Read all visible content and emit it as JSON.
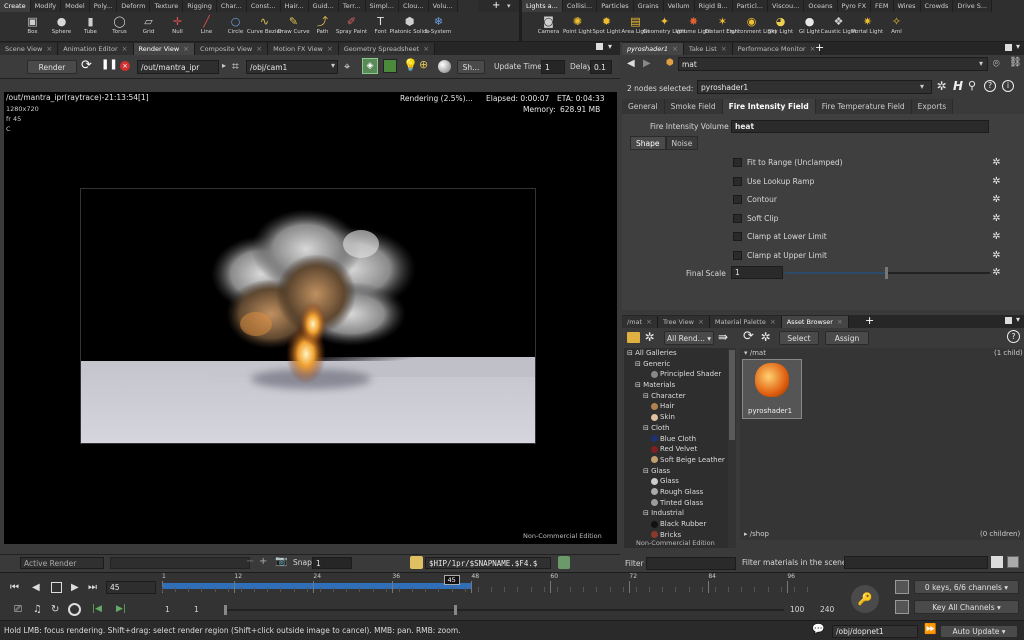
{
  "shelf_tabs_left": [
    "Create",
    "Modify",
    "Model",
    "Poly...",
    "Deform",
    "Texture",
    "Rigging",
    "Char...",
    "Const...",
    "Hair...",
    "Guid...",
    "Terr...",
    "Simpl...",
    "Clou...",
    "Volu..."
  ],
  "shelf_tabs_right": [
    "Lights a...",
    "Collisi...",
    "Particles",
    "Grains",
    "Vellum",
    "Rigid B...",
    "Particl...",
    "Viscou...",
    "Oceans",
    "Pyro FX",
    "FEM",
    "Wires",
    "Crowds",
    "Drive S..."
  ],
  "tools_left": [
    {
      "label": "Box",
      "icon": "cube-icon",
      "glyph": "▣",
      "color": "#cfcfcf"
    },
    {
      "label": "Sphere",
      "icon": "sphere-icon",
      "glyph": "●",
      "color": "#d8d8d8"
    },
    {
      "label": "Tube",
      "icon": "tube-icon",
      "glyph": "▮",
      "color": "#cfcfcf"
    },
    {
      "label": "Torus",
      "icon": "torus-icon",
      "glyph": "◯",
      "color": "#cfcfcf"
    },
    {
      "label": "Grid",
      "icon": "grid-icon",
      "glyph": "▱",
      "color": "#cfcfcf"
    },
    {
      "label": "Null",
      "icon": "null-icon",
      "glyph": "✛",
      "color": "#e05050"
    },
    {
      "label": "Line",
      "icon": "line-icon",
      "glyph": "╱",
      "color": "#e05050"
    },
    {
      "label": "Circle",
      "icon": "circle-icon",
      "glyph": "○",
      "color": "#6aa0e0"
    },
    {
      "label": "Curve Bezier",
      "icon": "curve-bezier-icon",
      "glyph": "∿",
      "color": "#e0c050"
    },
    {
      "label": "Draw Curve",
      "icon": "draw-curve-icon",
      "glyph": "✎",
      "color": "#e0c050"
    },
    {
      "label": "Path",
      "icon": "path-icon",
      "glyph": "⤴",
      "color": "#e0c050"
    },
    {
      "label": "Spray Paint",
      "icon": "spray-paint-icon",
      "glyph": "✐",
      "color": "#e06060"
    },
    {
      "label": "Font",
      "icon": "font-icon",
      "glyph": "T",
      "color": "#e0e0e0"
    },
    {
      "label": "Platonic Solids",
      "icon": "platonic-solids-icon",
      "glyph": "⬢",
      "color": "#cfcfcf"
    },
    {
      "label": "L-System",
      "icon": "l-system-icon",
      "glyph": "❄",
      "color": "#6aa0e0"
    }
  ],
  "tools_right": [
    {
      "label": "Camera",
      "icon": "camera-icon",
      "glyph": "◙",
      "color": "#cfcfcf"
    },
    {
      "label": "Point Light",
      "icon": "point-light-icon",
      "glyph": "✺",
      "color": "#f0c030"
    },
    {
      "label": "Spot Light",
      "icon": "spot-light-icon",
      "glyph": "✹",
      "color": "#f0c030"
    },
    {
      "label": "Area Light",
      "icon": "area-light-icon",
      "glyph": "▤",
      "color": "#f0c030"
    },
    {
      "label": "Geometry Light",
      "icon": "geometry-light-icon",
      "glyph": "✦",
      "color": "#f0c030"
    },
    {
      "label": "Volume Light",
      "icon": "volume-light-icon",
      "glyph": "✸",
      "color": "#e06030"
    },
    {
      "label": "Distant Light",
      "icon": "distant-light-icon",
      "glyph": "✶",
      "color": "#f0c030"
    },
    {
      "label": "Environment Light",
      "icon": "environment-light-icon",
      "glyph": "◉",
      "color": "#f0c030"
    },
    {
      "label": "Sky Light",
      "icon": "sky-light-icon",
      "glyph": "◕",
      "color": "#f0d050"
    },
    {
      "label": "GI Light",
      "icon": "gi-light-icon",
      "glyph": "●",
      "color": "#e8e8e8"
    },
    {
      "label": "Caustic Light",
      "icon": "caustic-light-icon",
      "glyph": "❖",
      "color": "#d0d0d0"
    },
    {
      "label": "Portal Light",
      "icon": "portal-light-icon",
      "glyph": "✷",
      "color": "#f0c030"
    },
    {
      "label": "Aml",
      "icon": "ambient-light-icon",
      "glyph": "✧",
      "color": "#f0c030"
    }
  ],
  "left_tabs": [
    "Scene View",
    "Animation Editor",
    "Render View",
    "Composite View",
    "Motion FX View",
    "Geometry Spreadsheet"
  ],
  "render_toolbar": {
    "render": "Render",
    "driver": "/out/mantra_ipr",
    "camera": "/obj/cam1",
    "snap": "Sh...",
    "update_label": "Update Time",
    "update_value": "1",
    "delay_label": "Delay",
    "delay_value": "0.1"
  },
  "render_info": {
    "title": "/out/mantra_ipr(raytrace)-21:13:54[1]",
    "res": "1280x720",
    "frame": "fr 45",
    "chan": "C",
    "status": "Rendering (2.5%)...",
    "elapsed": "Elapsed: 0:00:07",
    "eta": "ETA: 0:04:33",
    "memory": "Memory:",
    "memory_value": "628.91 MB",
    "edition": "Non-Commercial Edition"
  },
  "render_bottom": {
    "active": "Active Render",
    "snap": "Snap",
    "snap_value": "1",
    "path": "$HIP/1pr/$SNAPNAME.$F4.$"
  },
  "right_top_tabs": [
    "pyroshader1",
    "Take List",
    "Performance Monitor"
  ],
  "param": {
    "path": "mat",
    "nodes_label": "2 nodes selected:",
    "nodes_value": "pyroshader1",
    "tabs": [
      "General",
      "Smoke Field",
      "Fire Intensity Field",
      "Fire Temperature Field",
      "Exports"
    ],
    "vol_label": "Fire Intensity Volume",
    "vol_value": "heat",
    "subtabs": [
      "Shape",
      "Noise"
    ],
    "checks": [
      "Fit to Range (Unclamped)",
      "Use Lookup Ramp",
      "Contour",
      "Soft Clip",
      "Clamp at Lower Limit",
      "Clamp at Upper Limit"
    ],
    "scale_label": "Final Scale",
    "scale_value": "1"
  },
  "mat_tabs": [
    "/mat",
    "Tree View",
    "Material Palette",
    "Asset Browser"
  ],
  "mat_toolbar": {
    "renderer": "All Rend...",
    "select": "Select",
    "assign": "Assign"
  },
  "gallery": [
    {
      "text": "All Galleries",
      "lvl": 0,
      "exp": "⊟",
      "dot": ""
    },
    {
      "text": "Generic",
      "lvl": 1,
      "exp": "⊟",
      "dot": ""
    },
    {
      "text": "Principled Shader",
      "lvl": 3,
      "exp": "",
      "dot": "#888"
    },
    {
      "text": "Materials",
      "lvl": 1,
      "exp": "⊟",
      "dot": ""
    },
    {
      "text": "Character",
      "lvl": 2,
      "exp": "⊟",
      "dot": ""
    },
    {
      "text": "Hair",
      "lvl": 3,
      "exp": "",
      "dot": "#b08050"
    },
    {
      "text": "Skin",
      "lvl": 3,
      "exp": "",
      "dot": "#e0c0a0"
    },
    {
      "text": "Cloth",
      "lvl": 2,
      "exp": "⊟",
      "dot": ""
    },
    {
      "text": "Blue Cloth",
      "lvl": 3,
      "exp": "",
      "dot": "#203070"
    },
    {
      "text": "Red Velvet",
      "lvl": 3,
      "exp": "",
      "dot": "#802020"
    },
    {
      "text": "Soft Beige Leather",
      "lvl": 3,
      "exp": "",
      "dot": "#c0a070"
    },
    {
      "text": "Glass",
      "lvl": 2,
      "exp": "⊟",
      "dot": ""
    },
    {
      "text": "Glass",
      "lvl": 3,
      "exp": "",
      "dot": "#cccccc"
    },
    {
      "text": "Rough Glass",
      "lvl": 3,
      "exp": "",
      "dot": "#aaaaaa"
    },
    {
      "text": "Tinted Glass",
      "lvl": 3,
      "exp": "",
      "dot": "#9a9a9a"
    },
    {
      "text": "Industrial",
      "lvl": 2,
      "exp": "⊟",
      "dot": ""
    },
    {
      "text": "Black Rubber",
      "lvl": 3,
      "exp": "",
      "dot": "#111111"
    },
    {
      "text": "Bricks",
      "lvl": 3,
      "exp": "",
      "dot": "#8a3a2a"
    }
  ],
  "mat_panel": {
    "path": "/mat",
    "count": "(1 child)",
    "node": "pyroshader1",
    "shop_path": "/shop",
    "shop_count": "(0 children)",
    "filter_label": "Filter",
    "filter_mats": "Filter materials in the scene:",
    "edition": "Non-Commercial Edition"
  },
  "timeline": {
    "ticks": [
      "1",
      "12",
      "24",
      "36",
      "48",
      "60",
      "72",
      "84",
      "96"
    ],
    "current": "45",
    "frame_field": "45",
    "start": "1",
    "start2": "1",
    "end1": "100",
    "end2": "240",
    "progress": 0.45
  },
  "keys": {
    "status": "0 keys, 6/6 channels",
    "key_all": "Key All Channels"
  },
  "status": {
    "text": "Hold LMB: focus rendering. Shift+drag: select render region (Shift+click outside image to cancel). MMB: pan. RMB: zoom.",
    "path": "/obj/dopnet1",
    "update": "Auto Update"
  }
}
